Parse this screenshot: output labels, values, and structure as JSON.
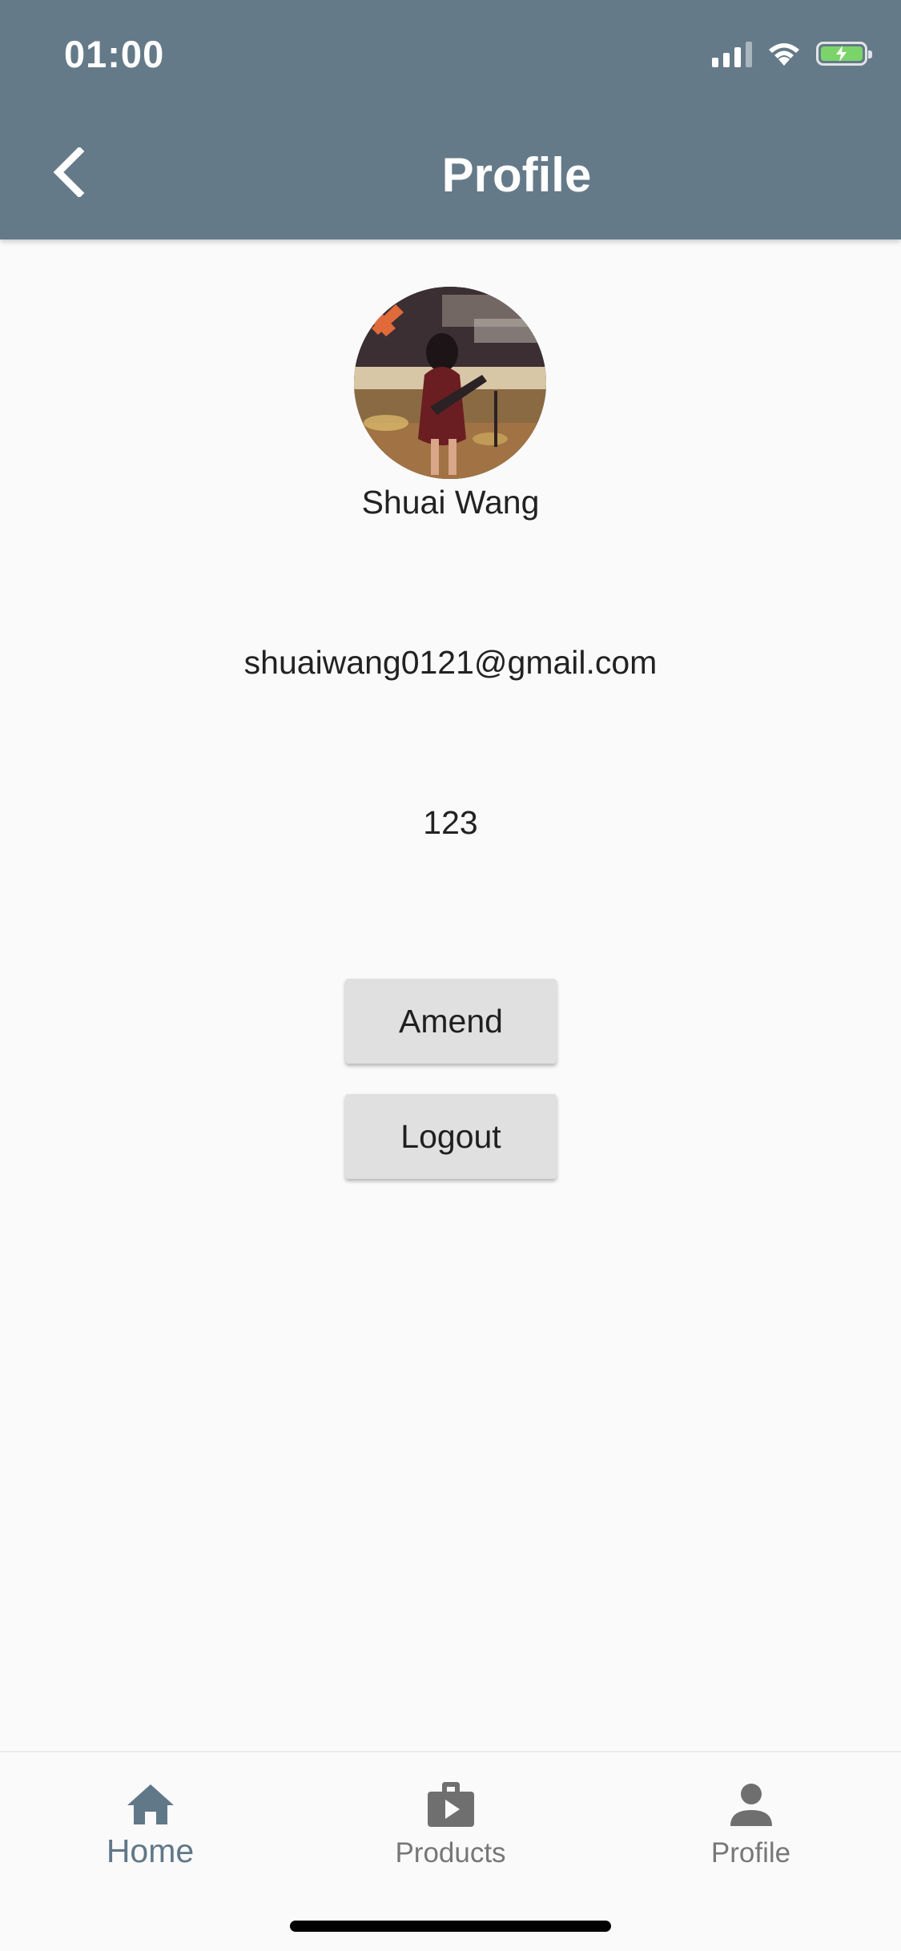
{
  "status_bar": {
    "time": "01:00"
  },
  "header": {
    "title": "Profile",
    "back_icon": "chevron-left-icon"
  },
  "profile": {
    "avatar_icon": "user-photo",
    "name": "Shuai Wang",
    "email": "shuaiwang0121@gmail.com",
    "extra": "123"
  },
  "actions": {
    "amend_label": "Amend",
    "logout_label": "Logout"
  },
  "bottom_nav": {
    "items": [
      {
        "label": "Home",
        "icon": "home-icon",
        "active": true
      },
      {
        "label": "Products",
        "icon": "products-icon",
        "active": false
      },
      {
        "label": "Profile",
        "icon": "person-icon",
        "active": false
      }
    ]
  },
  "colors": {
    "app_bar": "#657a88",
    "active_nav": "#607888",
    "inactive_nav": "#777777",
    "button_bg": "#e0e0e0",
    "battery": "#7bd46a"
  }
}
